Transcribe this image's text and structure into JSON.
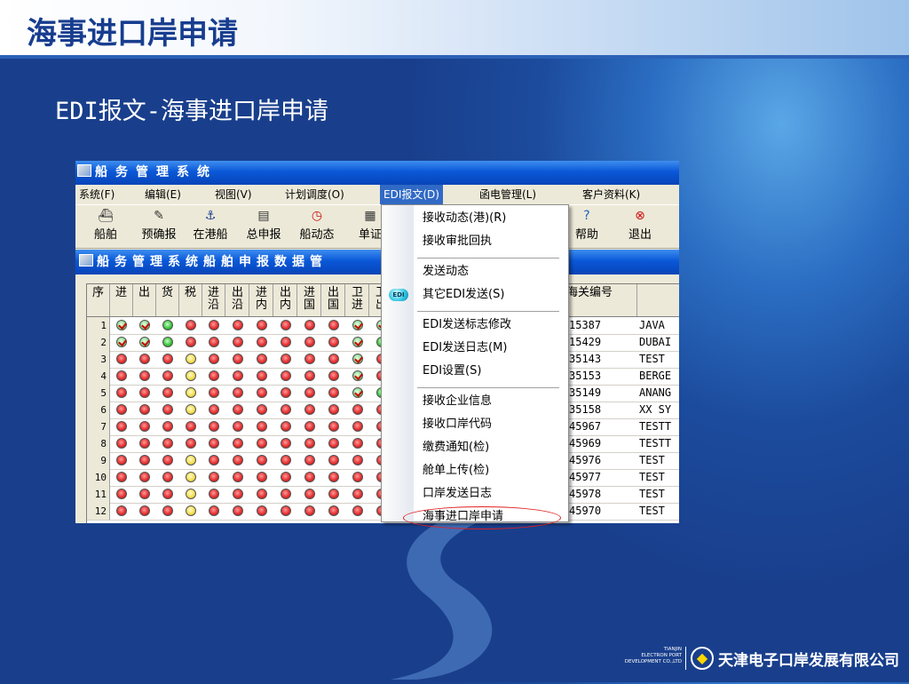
{
  "slide": {
    "title": "海事进口岸申请",
    "subtitle": "EDI报文-海事进口岸申请"
  },
  "app": {
    "title": "船务管理系统",
    "menu": [
      {
        "label": "系统(F)"
      },
      {
        "label": "编辑(E)"
      },
      {
        "label": "视图(V)"
      },
      {
        "label": "计划调度(O)"
      },
      {
        "label": "EDI报文(D)",
        "active": true
      },
      {
        "label": "函电管理(L)"
      },
      {
        "label": "客户资料(K)"
      }
    ],
    "toolbar": [
      {
        "label": "船舶",
        "icon": "ship-icon"
      },
      {
        "label": "预确报",
        "icon": "report-icon"
      },
      {
        "label": "在港船",
        "icon": "port-ship-icon"
      },
      {
        "label": "总申报",
        "icon": "declare-icon"
      },
      {
        "label": "船动态",
        "icon": "clock-icon"
      },
      {
        "label": "单证",
        "icon": "doc-icon"
      },
      {
        "label": "帮助",
        "icon": "help-icon"
      },
      {
        "label": "退出",
        "icon": "exit-icon"
      }
    ],
    "subwindow_title": "船务管理系统船舶申报数据管",
    "grid": {
      "headers": [
        {
          "label": "序"
        },
        {
          "label": "进"
        },
        {
          "label": "出"
        },
        {
          "label": "货"
        },
        {
          "label": "税"
        },
        {
          "label": "进\n沿"
        },
        {
          "label": "出\n沿"
        },
        {
          "label": "进\n内"
        },
        {
          "label": "出\n内"
        },
        {
          "label": "进\n国"
        },
        {
          "label": "出\n国"
        },
        {
          "label": "卫\n进"
        },
        {
          "label": "卫\n出"
        },
        {
          "label": "海关编号"
        },
        {
          "label": ""
        }
      ],
      "rows": [
        {
          "num": "1",
          "status": [
            "check",
            "check",
            "green",
            "red",
            "red",
            "red",
            "red",
            "red",
            "red",
            "red",
            "check",
            "check"
          ],
          "code": "15387",
          "name": "JAVA"
        },
        {
          "num": "2",
          "status": [
            "check",
            "check",
            "green",
            "red",
            "red",
            "red",
            "red",
            "red",
            "red",
            "red",
            "check",
            "green"
          ],
          "code": "15429",
          "name": "DUBAI"
        },
        {
          "num": "3",
          "status": [
            "red",
            "red",
            "red",
            "yellow",
            "red",
            "red",
            "red",
            "red",
            "red",
            "red",
            "check",
            "red"
          ],
          "code": "35143",
          "name": "TEST"
        },
        {
          "num": "4",
          "status": [
            "red",
            "red",
            "red",
            "yellow",
            "red",
            "red",
            "red",
            "red",
            "red",
            "red",
            "check",
            "red"
          ],
          "code": "35153",
          "name": "BERGE"
        },
        {
          "num": "5",
          "status": [
            "red",
            "red",
            "red",
            "yellow",
            "red",
            "red",
            "red",
            "red",
            "red",
            "red",
            "check",
            "green"
          ],
          "code": "35149",
          "name": "ANANG"
        },
        {
          "num": "6",
          "status": [
            "red",
            "red",
            "red",
            "yellow",
            "red",
            "red",
            "red",
            "red",
            "red",
            "red",
            "red",
            "red"
          ],
          "code": "35158",
          "name": "XX SY"
        },
        {
          "num": "7",
          "status": [
            "red",
            "red",
            "red",
            "red",
            "red",
            "red",
            "red",
            "red",
            "red",
            "red",
            "red",
            "red"
          ],
          "code": "45967",
          "name": "TESTT"
        },
        {
          "num": "8",
          "status": [
            "red",
            "red",
            "red",
            "red",
            "red",
            "red",
            "red",
            "red",
            "red",
            "red",
            "red",
            "red"
          ],
          "code": "45969",
          "name": "TESTT"
        },
        {
          "num": "9",
          "status": [
            "red",
            "red",
            "red",
            "yellow",
            "red",
            "red",
            "red",
            "red",
            "red",
            "red",
            "red",
            "red"
          ],
          "code": "45976",
          "name": "TEST"
        },
        {
          "num": "10",
          "status": [
            "red",
            "red",
            "red",
            "yellow",
            "red",
            "red",
            "red",
            "red",
            "red",
            "red",
            "red",
            "red"
          ],
          "code": "45977",
          "name": "TEST"
        },
        {
          "num": "11",
          "status": [
            "red",
            "red",
            "red",
            "yellow",
            "red",
            "red",
            "red",
            "red",
            "red",
            "red",
            "red",
            "red"
          ],
          "code": "45978",
          "name": "TEST"
        },
        {
          "num": "12",
          "status": [
            "red",
            "red",
            "red",
            "yellow",
            "red",
            "red",
            "red",
            "red",
            "red",
            "red",
            "red",
            "red"
          ],
          "code": "45970",
          "name": "TEST"
        }
      ]
    },
    "dropdown": {
      "badge": "EDI",
      "items": [
        {
          "label": "接收动态(港)(R)"
        },
        {
          "label": "接收审批回执"
        },
        {
          "sep": true
        },
        {
          "label": "发送动态"
        },
        {
          "label": "其它EDI发送(S)",
          "icon": true
        },
        {
          "sep": true
        },
        {
          "label": "EDI发送标志修改"
        },
        {
          "label": "EDI发送日志(M)"
        },
        {
          "label": "EDI设置(S)"
        },
        {
          "sep": true
        },
        {
          "label": "接收企业信息"
        },
        {
          "label": "接收口岸代码"
        },
        {
          "label": "缴费通知(检)"
        },
        {
          "label": "舱单上传(检)"
        },
        {
          "label": "口岸发送日志"
        },
        {
          "label": "海事进口岸申请",
          "highlighted": true
        }
      ]
    }
  },
  "logo": {
    "line1": "TIANJIN",
    "line2": "ELECTRON PORT",
    "line3": "DEVELOPMENT CO.,LTD",
    "name": "天津电子口岸发展有限公司"
  },
  "colors": {
    "background": "#1c4b9d",
    "titlebar_blue": "#0a58d8",
    "menu_highlight": "#316ac5",
    "highlight_ring": "#e02020"
  }
}
